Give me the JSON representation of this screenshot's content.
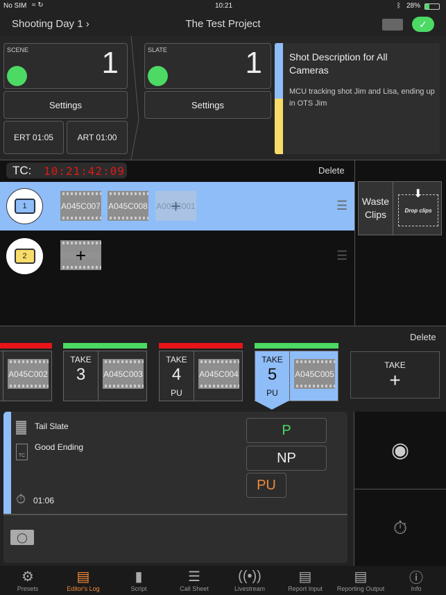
{
  "status_bar": {
    "carrier": "No SIM",
    "time": "10:21",
    "battery": "28%"
  },
  "nav": {
    "day": "Shooting Day 1",
    "title": "The Test Project"
  },
  "scene": {
    "label": "SCENE",
    "value": "1",
    "settings": "Settings",
    "ert": "ERT 01:05",
    "art": "ART 01:00"
  },
  "slate": {
    "label": "SLATE",
    "value": "1",
    "settings": "Settings"
  },
  "shot": {
    "title": "Shot Description for All Cameras",
    "description": "MCU tracking shot Jim and Lisa, ending up in OTS Jim"
  },
  "tc": {
    "label": "TC:",
    "value": "10:21:42:09",
    "delete": "Delete"
  },
  "cameras": [
    {
      "number": "1",
      "clips": [
        [
          "A045",
          "C007"
        ],
        [
          "A045",
          "C008"
        ]
      ],
      "placeholder": [
        "A001",
        "C001"
      ]
    },
    {
      "number": "2",
      "clips": [],
      "placeholder": [
        "B001",
        "C001"
      ]
    }
  ],
  "waste": {
    "label": "Waste Clips",
    "drop": "Drop clips"
  },
  "takes": {
    "delete": "Delete",
    "new_label": "TAKE",
    "items": [
      {
        "take": "",
        "number": "",
        "flag": "",
        "clip": [
          "A045",
          "C002"
        ],
        "status_color": "#e8141a"
      },
      {
        "take": "TAKE",
        "number": "3",
        "flag": "",
        "clip": [
          "A045",
          "C003"
        ],
        "status_color": "#4cd964"
      },
      {
        "take": "TAKE",
        "number": "4",
        "flag": "PU",
        "clip": [
          "A045",
          "C004"
        ],
        "status_color": "#e8141a"
      },
      {
        "take": "TAKE",
        "number": "5",
        "flag": "PU",
        "clip": [
          "A045",
          "C005"
        ],
        "status_color": "#4cd964"
      }
    ]
  },
  "detail": {
    "tail_slate": "Tail Slate",
    "good_ending": "Good Ending",
    "duration": "01:06",
    "p": "P",
    "np": "NP",
    "pu": "PU"
  },
  "tabs": [
    "Presets",
    "Editor's Log",
    "Script",
    "Call Sheet",
    "Livestream",
    "Report Input",
    "Reporting Output",
    "Info"
  ],
  "colors": {
    "accent": "#f08a3c",
    "selected": "#8fbdf8",
    "green": "#4cd964",
    "yellow": "#f8dc6a",
    "red": "#e8141a"
  }
}
